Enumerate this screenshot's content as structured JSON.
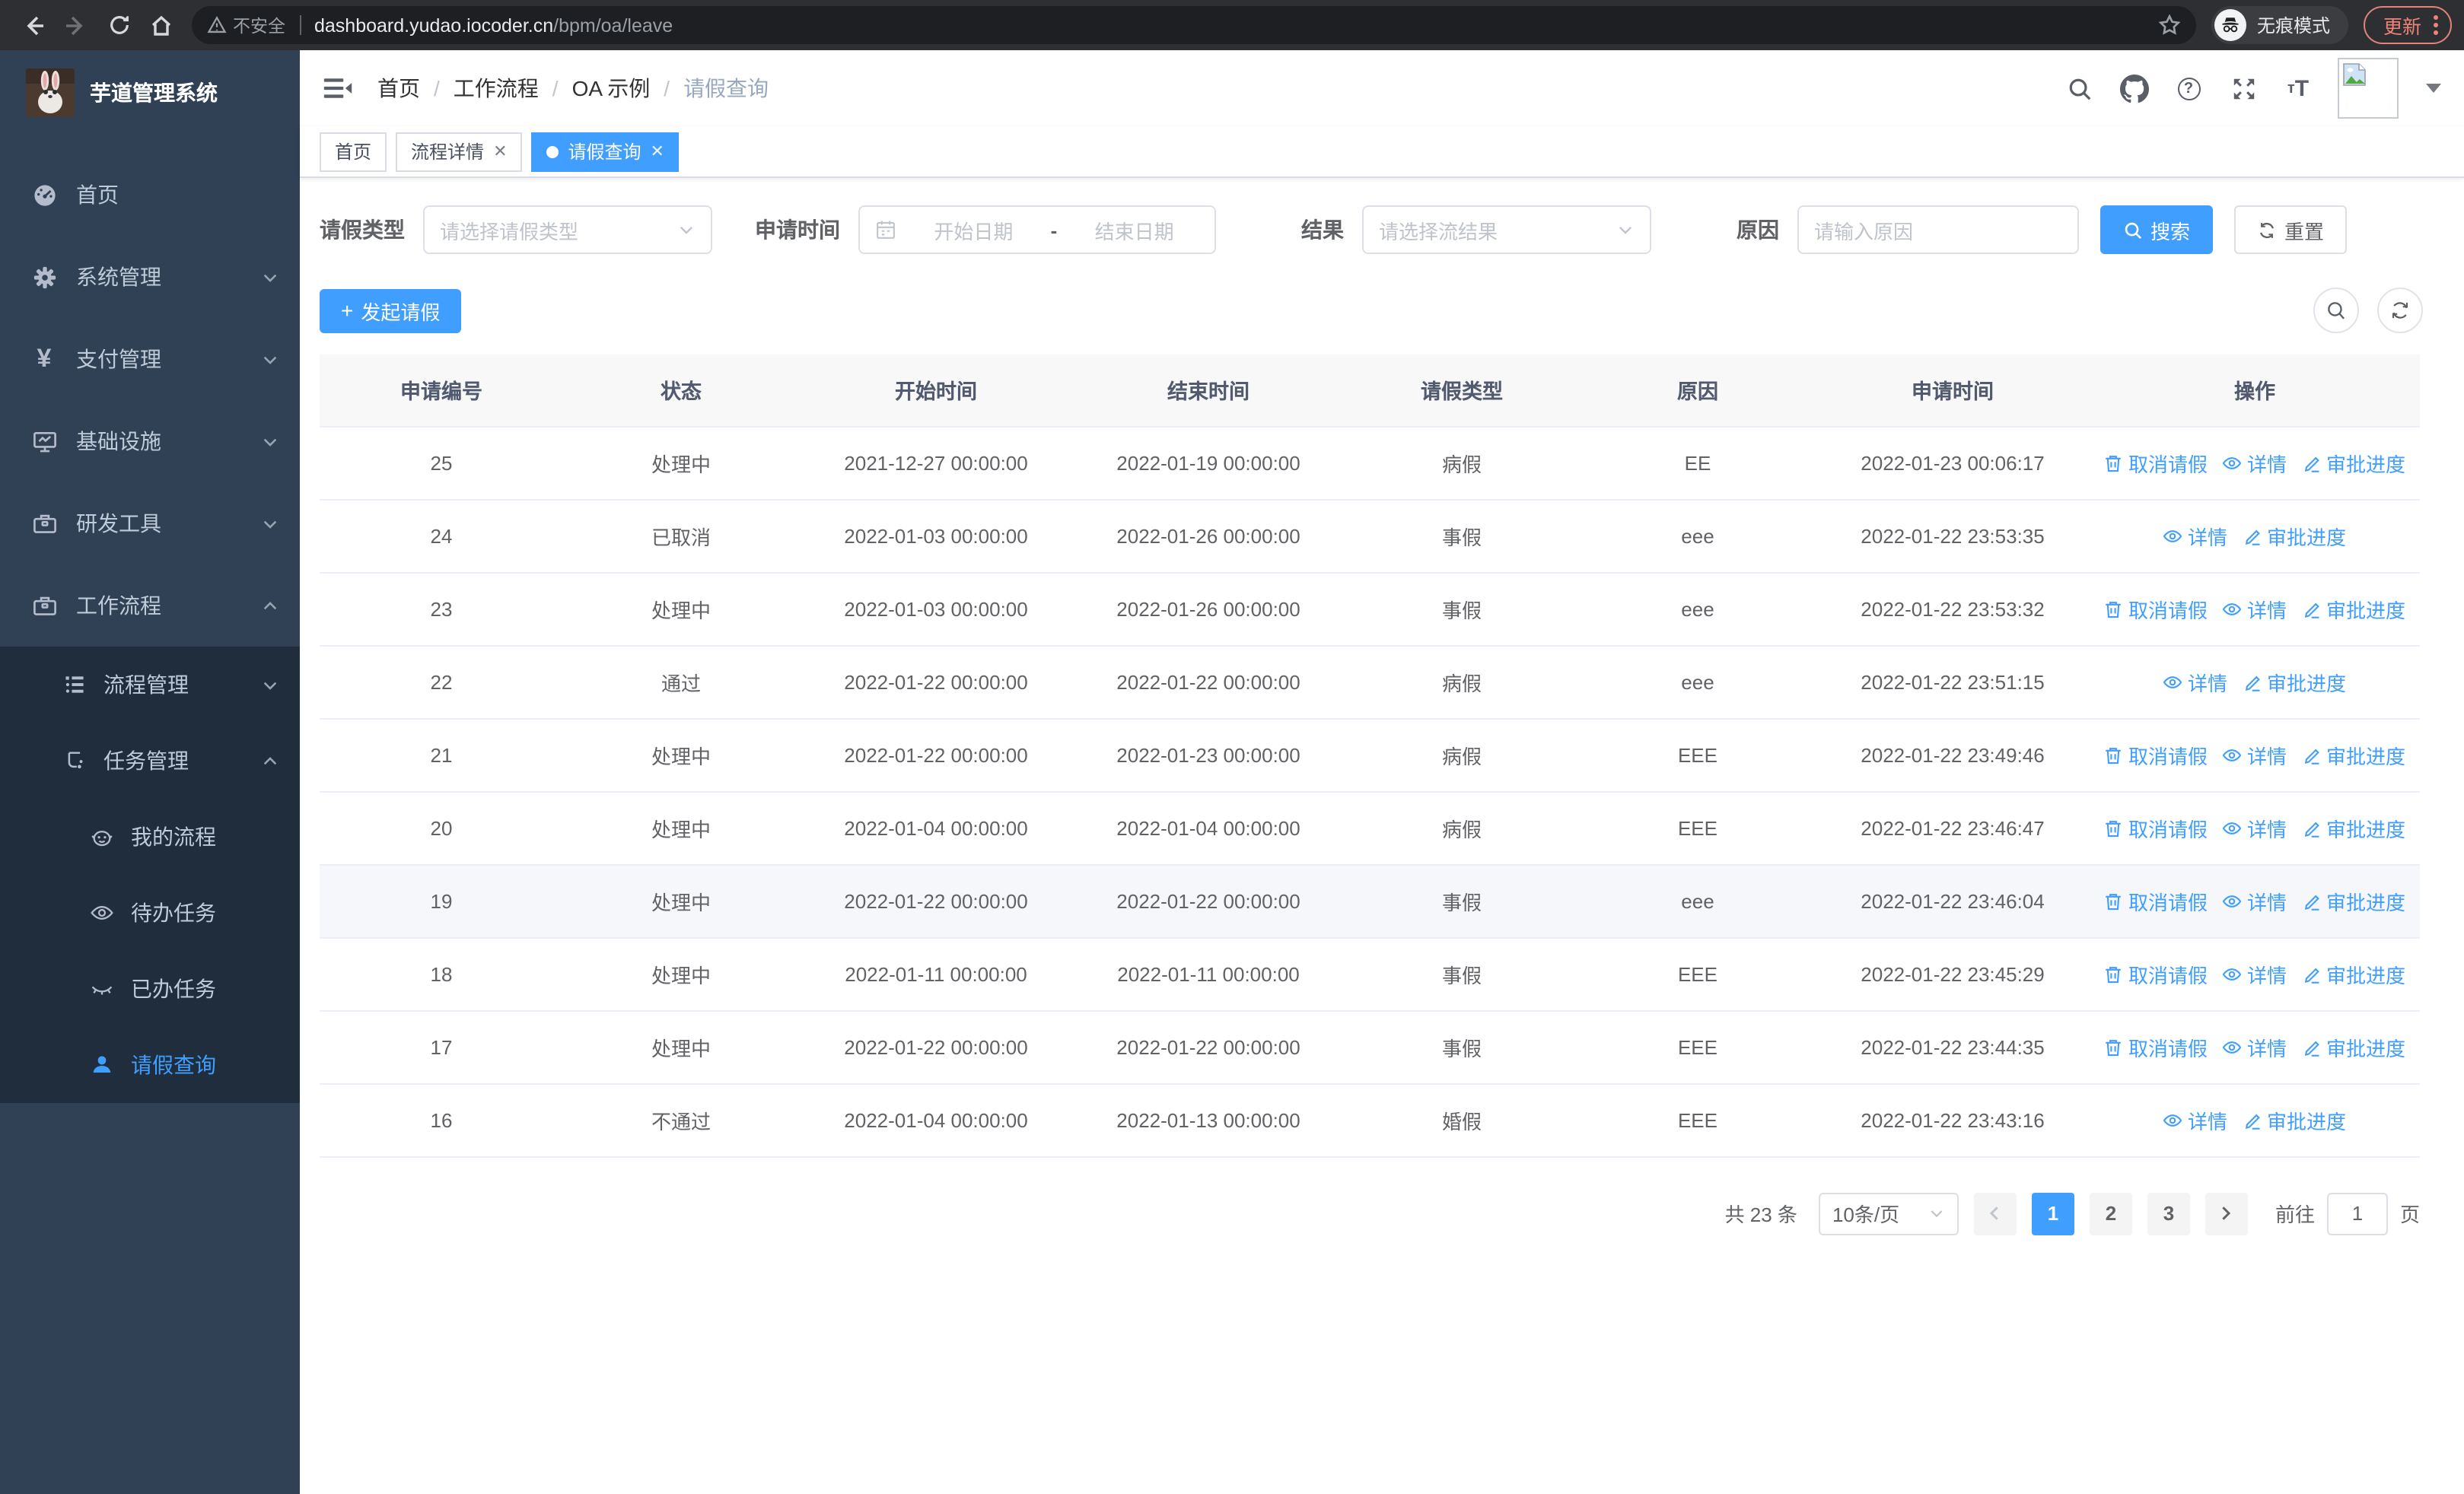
{
  "browser": {
    "security_label": "不安全",
    "url_host": "dashboard.yudao.iocoder.cn",
    "url_path": "/bpm/oa/leave",
    "incognito_label": "无痕模式",
    "update_label": "更新"
  },
  "sidebar": {
    "title": "芋道管理系统",
    "home": "首页",
    "system": "系统管理",
    "payment": "支付管理",
    "infra": "基础设施",
    "devtools": "研发工具",
    "workflow": "工作流程",
    "process_mgmt": "流程管理",
    "task_mgmt": "任务管理",
    "my_process": "我的流程",
    "todo_tasks": "待办任务",
    "done_tasks": "已办任务",
    "leave_query": "请假查询"
  },
  "breadcrumb": {
    "separator": "/",
    "items": [
      "首页",
      "工作流程",
      "OA 示例",
      "请假查询"
    ]
  },
  "tabs": [
    {
      "label": "首页",
      "closable": false,
      "active": false
    },
    {
      "label": "流程详情",
      "closable": true,
      "active": false
    },
    {
      "label": "请假查询",
      "closable": true,
      "active": true
    }
  ],
  "filters": {
    "leave_type_label": "请假类型",
    "leave_type_placeholder": "请选择请假类型",
    "apply_time_label": "申请时间",
    "start_date_placeholder": "开始日期",
    "range_separator": "-",
    "end_date_placeholder": "结束日期",
    "result_label": "结果",
    "result_placeholder": "请选择流结果",
    "reason_label": "原因",
    "reason_placeholder": "请输入原因",
    "search_label": "搜索",
    "reset_label": "重置"
  },
  "toolbar": {
    "create_label": "发起请假"
  },
  "table": {
    "columns": [
      "申请编号",
      "状态",
      "开始时间",
      "结束时间",
      "请假类型",
      "原因",
      "申请时间",
      "操作"
    ],
    "rows": [
      {
        "id": "25",
        "status": "处理中",
        "start": "2021-12-27 00:00:00",
        "end": "2022-01-19 00:00:00",
        "type": "病假",
        "reason": "EE",
        "applied": "2022-01-23 00:06:17",
        "actions": [
          "取消请假",
          "详情",
          "审批进度"
        ],
        "highlighted": false
      },
      {
        "id": "24",
        "status": "已取消",
        "start": "2022-01-03 00:00:00",
        "end": "2022-01-26 00:00:00",
        "type": "事假",
        "reason": "eee",
        "applied": "2022-01-22 23:53:35",
        "actions": [
          "详情",
          "审批进度"
        ],
        "highlighted": false
      },
      {
        "id": "23",
        "status": "处理中",
        "start": "2022-01-03 00:00:00",
        "end": "2022-01-26 00:00:00",
        "type": "事假",
        "reason": "eee",
        "applied": "2022-01-22 23:53:32",
        "actions": [
          "取消请假",
          "详情",
          "审批进度"
        ],
        "highlighted": false
      },
      {
        "id": "22",
        "status": "通过",
        "start": "2022-01-22 00:00:00",
        "end": "2022-01-22 00:00:00",
        "type": "病假",
        "reason": "eee",
        "applied": "2022-01-22 23:51:15",
        "actions": [
          "详情",
          "审批进度"
        ],
        "highlighted": false
      },
      {
        "id": "21",
        "status": "处理中",
        "start": "2022-01-22 00:00:00",
        "end": "2022-01-23 00:00:00",
        "type": "病假",
        "reason": "EEE",
        "applied": "2022-01-22 23:49:46",
        "actions": [
          "取消请假",
          "详情",
          "审批进度"
        ],
        "highlighted": false
      },
      {
        "id": "20",
        "status": "处理中",
        "start": "2022-01-04 00:00:00",
        "end": "2022-01-04 00:00:00",
        "type": "病假",
        "reason": "EEE",
        "applied": "2022-01-22 23:46:47",
        "actions": [
          "取消请假",
          "详情",
          "审批进度"
        ],
        "highlighted": false
      },
      {
        "id": "19",
        "status": "处理中",
        "start": "2022-01-22 00:00:00",
        "end": "2022-01-22 00:00:00",
        "type": "事假",
        "reason": "eee",
        "applied": "2022-01-22 23:46:04",
        "actions": [
          "取消请假",
          "详情",
          "审批进度"
        ],
        "highlighted": true
      },
      {
        "id": "18",
        "status": "处理中",
        "start": "2022-01-11 00:00:00",
        "end": "2022-01-11 00:00:00",
        "type": "事假",
        "reason": "EEE",
        "applied": "2022-01-22 23:45:29",
        "actions": [
          "取消请假",
          "详情",
          "审批进度"
        ],
        "highlighted": false
      },
      {
        "id": "17",
        "status": "处理中",
        "start": "2022-01-22 00:00:00",
        "end": "2022-01-22 00:00:00",
        "type": "事假",
        "reason": "EEE",
        "applied": "2022-01-22 23:44:35",
        "actions": [
          "取消请假",
          "详情",
          "审批进度"
        ],
        "highlighted": false
      },
      {
        "id": "16",
        "status": "不通过",
        "start": "2022-01-04 00:00:00",
        "end": "2022-01-13 00:00:00",
        "type": "婚假",
        "reason": "EEE",
        "applied": "2022-01-22 23:43:16",
        "actions": [
          "详情",
          "审批进度"
        ],
        "highlighted": false
      }
    ]
  },
  "pagination": {
    "total_label": "共 23 条",
    "page_size_label": "10条/页",
    "pages": [
      "1",
      "2",
      "3"
    ],
    "active_page": "1",
    "goto_label": "前往",
    "goto_value": "1",
    "page_suffix": "页"
  },
  "icons": {
    "action_icons": {
      "取消请假": "delete-icon",
      "详情": "view-icon",
      "审批进度": "edit-icon"
    },
    "header_icons": [
      "search-icon",
      "github-icon",
      "help-icon",
      "fullscreen-icon",
      "font-size-icon"
    ]
  },
  "colors": {
    "primary": "#409eff",
    "sidebar_bg": "#304156",
    "submenu_bg": "#1f2d3d",
    "chrome_bg": "#2e2f33",
    "update_accent": "#ee8377"
  }
}
